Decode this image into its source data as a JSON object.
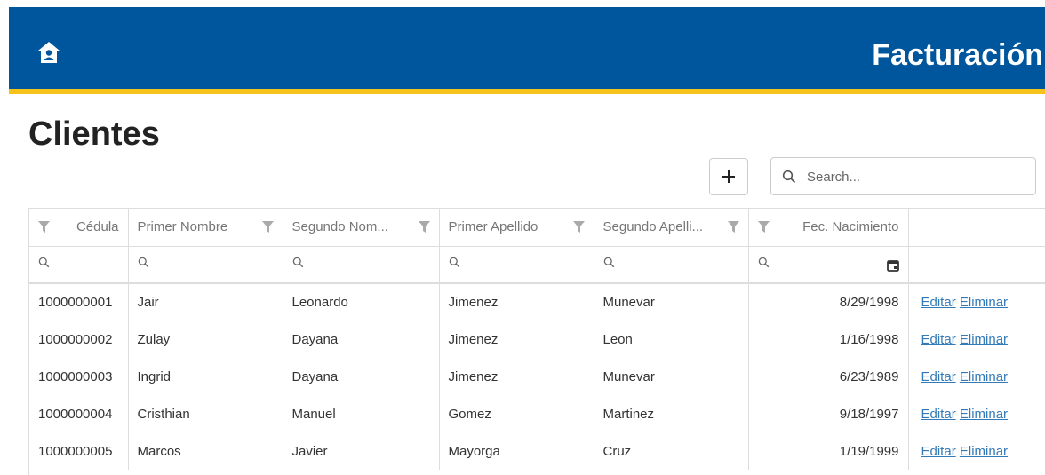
{
  "header": {
    "title": "Facturación",
    "home_icon": "home-icon",
    "bg": "#00569c",
    "accent": "#f5c31c"
  },
  "page": {
    "title": "Clientes"
  },
  "toolbar": {
    "add_icon": "plus-icon",
    "search_placeholder": "Search..."
  },
  "grid": {
    "columns": [
      "Cédula",
      "Primer Nombre",
      "Segundo Nom...",
      "Primer Apellido",
      "Segundo Apelli...",
      "Fec. Nacimiento",
      ""
    ],
    "rows": [
      {
        "cedula": "1000000001",
        "primer_nombre": "Jair",
        "segundo_nombre": "Leonardo",
        "primer_apellido": "Jimenez",
        "segundo_apellido": "Munevar",
        "fec_nacimiento": "8/29/1998"
      },
      {
        "cedula": "1000000002",
        "primer_nombre": "Zulay",
        "segundo_nombre": "Dayana",
        "primer_apellido": "Jimenez",
        "segundo_apellido": "Leon",
        "fec_nacimiento": "1/16/1998"
      },
      {
        "cedula": "1000000003",
        "primer_nombre": "Ingrid",
        "segundo_nombre": "Dayana",
        "primer_apellido": "Jimenez",
        "segundo_apellido": "Munevar",
        "fec_nacimiento": "6/23/1989"
      },
      {
        "cedula": "1000000004",
        "primer_nombre": "Cristhian",
        "segundo_nombre": "Manuel",
        "primer_apellido": "Gomez",
        "segundo_apellido": "Martinez",
        "fec_nacimiento": "9/18/1997"
      },
      {
        "cedula": "1000000005",
        "primer_nombre": "Marcos",
        "segundo_nombre": "Javier",
        "primer_apellido": "Mayorga",
        "segundo_apellido": "Cruz",
        "fec_nacimiento": "1/19/1999"
      }
    ],
    "actions": {
      "edit": "Editar",
      "delete": "Eliminar",
      "link_color": "#337ab7"
    }
  }
}
